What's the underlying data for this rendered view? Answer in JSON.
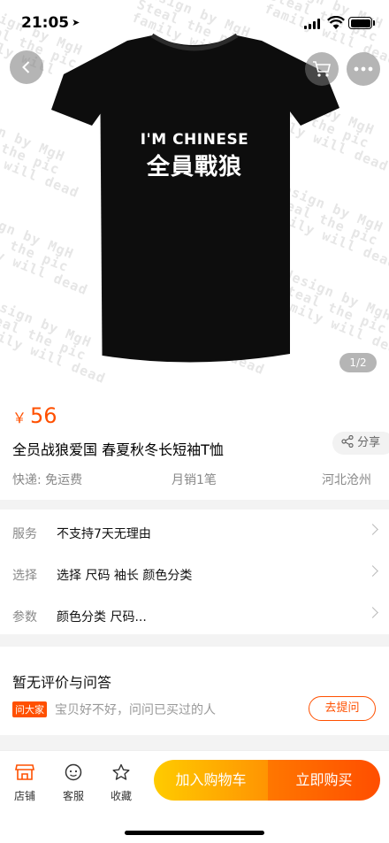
{
  "status": {
    "time": "21:05",
    "location_arrow": "➤"
  },
  "hero": {
    "shirt_line1": "I'M CHINESE",
    "shirt_line2": "全員戰狼",
    "image_counter": "1/2",
    "watermark_lines": [
      "design by MgH",
      "Steal the pic",
      "family will dead"
    ]
  },
  "product": {
    "currency": "￥",
    "price": "56",
    "title": "全员战狼爱国 春夏秋冬长短袖T恤",
    "share_label": "分享",
    "shipping": "快递: 免运费",
    "monthly_sales": "月销1笔",
    "location": "河北沧州"
  },
  "services": [
    {
      "label": "服务",
      "value": "不支持7天无理由"
    },
    {
      "label": "选择",
      "value": "选择  尺码 袖长 颜色分类"
    },
    {
      "label": "参数",
      "value": "颜色分类 尺码..."
    }
  ],
  "reviews": {
    "heading": "暂无评价与问答",
    "ask_badge": "问大家",
    "ask_prompt": "宝贝好不好，问问已买过的人",
    "ask_button": "去提问"
  },
  "bottom_bar": {
    "tabs": [
      {
        "label": "店铺",
        "icon": "store-icon"
      },
      {
        "label": "客服",
        "icon": "customer-service-icon"
      },
      {
        "label": "收藏",
        "icon": "star-icon"
      }
    ],
    "add_to_cart": "加入购物车",
    "buy_now": "立即购买"
  },
  "colors": {
    "accent": "#ff5000",
    "cart_gradient": [
      "#ffcb00",
      "#ff9402"
    ],
    "buy_gradient": [
      "#ff7700",
      "#ff4e00"
    ]
  }
}
